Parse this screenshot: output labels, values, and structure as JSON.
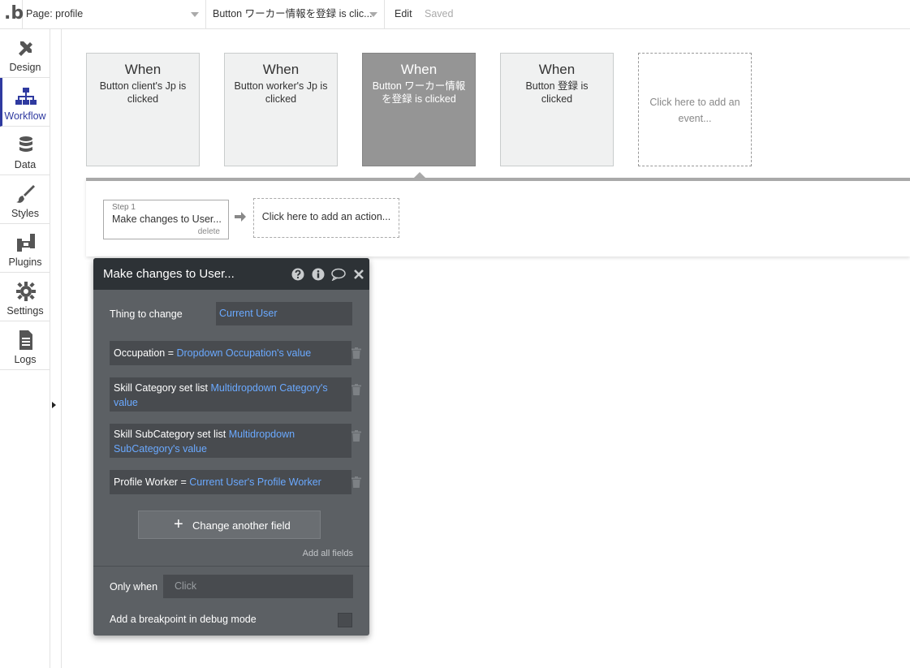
{
  "topbar": {
    "logo": ".b",
    "page_select": "Page: profile",
    "event_select": "Button ワーカー情報を登録 is clic...",
    "edit_menu": "Edit",
    "save_status": "Saved"
  },
  "sidebar": {
    "items": [
      {
        "label": "Design",
        "icon": "design-icon"
      },
      {
        "label": "Workflow",
        "icon": "workflow-icon",
        "active": true
      },
      {
        "label": "Data",
        "icon": "database-icon"
      },
      {
        "label": "Styles",
        "icon": "brush-icon"
      },
      {
        "label": "Plugins",
        "icon": "plugin-icon"
      },
      {
        "label": "Settings",
        "icon": "gear-icon"
      },
      {
        "label": "Logs",
        "icon": "document-icon"
      }
    ]
  },
  "events": [
    {
      "when": "When",
      "description": "Button client's Jp is clicked"
    },
    {
      "when": "When",
      "description": "Button worker's Jp is clicked"
    },
    {
      "when": "When",
      "description": "Button ワーカー情報を登録 is clicked",
      "selected": true
    },
    {
      "when": "When",
      "description": "Button 登録 is clicked"
    }
  ],
  "add_event_label": "Click here to add an event...",
  "step": {
    "number_label": "Step 1",
    "title": "Make changes to User...",
    "delete_label": "delete"
  },
  "add_action_label": "Click here to add an action...",
  "editor": {
    "title": "Make changes to User...",
    "thing_label": "Thing to change",
    "thing_value": "Current User",
    "conditions": [
      {
        "field": "Occupation",
        "op": " = ",
        "value": "Dropdown Occupation's value"
      },
      {
        "field": "Skill Category set list",
        "op": " ",
        "value": "Multidropdown Category's value"
      },
      {
        "field": "Skill SubCategory set list",
        "op": " ",
        "value": "Multidropdown SubCategory's value"
      },
      {
        "field": "Profile Worker",
        "op": " = ",
        "value": "Current User's Profile Worker"
      }
    ],
    "change_field_label": "Change another field",
    "add_all_label": "Add all fields",
    "only_when_label": "Only when",
    "only_when_placeholder": "Click",
    "breakpoint_label": "Add a breakpoint in debug mode"
  },
  "colors": {
    "accent": "#2f3aa0",
    "dynamic_value": "#6aa9ff",
    "editor_bg": "#5c6064",
    "editor_header": "#2d3236",
    "selected_event": "#959595"
  }
}
